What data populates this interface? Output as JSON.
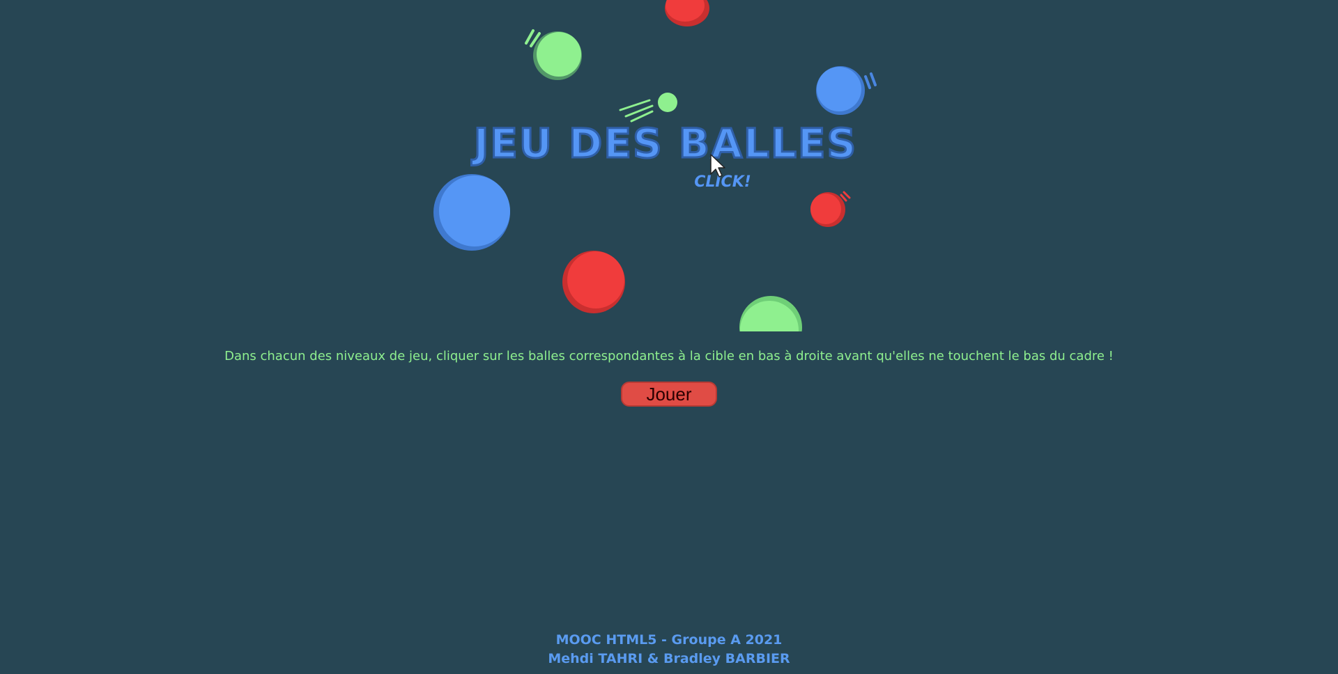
{
  "colors": {
    "background": "#274654",
    "blue_ball": "#5596f5",
    "red_ball": "#f03c3c",
    "green_ball": "#8ff08f",
    "instruction_text": "#8ff08f",
    "footer_text": "#5a9bf0",
    "button_bg": "#e04c45"
  },
  "logo": {
    "title": "JEU DES BALLES",
    "tagline": "CLICK!"
  },
  "intro": {
    "instructions": "Dans chacun des niveaux de jeu, cliquer sur les balles correspondantes à la cible en bas à droite avant qu'elles ne touchent le bas du cadre !"
  },
  "play_button": {
    "label": "Jouer"
  },
  "footer": {
    "line1": "MOOC HTML5 - Groupe A 2021",
    "line2": "Mehdi TAHRI & Bradley BARBIER"
  }
}
